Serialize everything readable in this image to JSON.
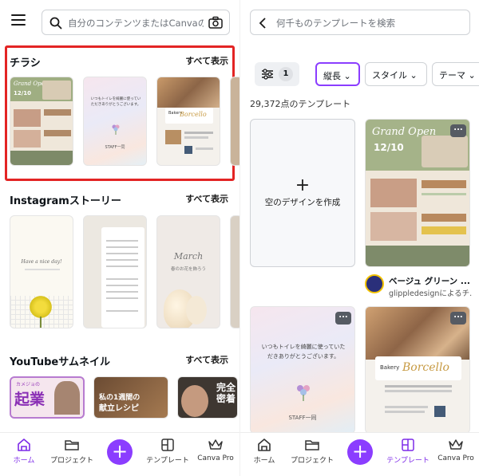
{
  "left": {
    "search_placeholder": "自分のコンテンツまたはCanvaのコン",
    "sections": [
      {
        "title": "チラシ",
        "see_all": "すべて表示"
      },
      {
        "title": "Instagramストーリー",
        "see_all": "すべて表示"
      },
      {
        "title": "YouTubeサムネイル",
        "see_all": "すべて表示"
      }
    ],
    "flyer_thumbs": {
      "grand_open_text": "Grand Open",
      "date_text": "12/10",
      "pastel_text": "いつもトイレを綺麗に使っていただきありがとうございます。",
      "pastel_staff": "STAFF一同",
      "bakery_text": "Bakery",
      "bakery_name": "Borcello"
    },
    "story_thumbs": {
      "story1_text": "Have a nice day!",
      "story3_title": "March",
      "story3_sub": "春のお花を飾ろう"
    },
    "yt_thumbs": {
      "yt1_small": "カメジョの",
      "yt1_big": "起業",
      "yt2_line1": "私の1週間の",
      "yt2_line2": "献立レシピ",
      "yt3_text": "完全密着"
    },
    "nav": [
      {
        "label": "ホーム",
        "icon": "home-icon"
      },
      {
        "label": "プロジェクト",
        "icon": "folder-icon"
      },
      {
        "label": "テンプレート",
        "icon": "template-icon"
      },
      {
        "label": "Canva Pro",
        "icon": "crown-icon"
      }
    ]
  },
  "right": {
    "search_placeholder": "何千ものテンプレートを検索",
    "filter_count": "1",
    "chips": [
      "縦長",
      "スタイル",
      "テーマ"
    ],
    "result_count": "29,372点のテンプレート",
    "create_blank": "空のデザインを作成",
    "create_plus": "+",
    "card_menu": "...",
    "author_title": "ベージュ グリーン ...",
    "author_name": "glippledesignによるチ...",
    "nav": [
      {
        "label": "ホーム",
        "icon": "home-icon"
      },
      {
        "label": "プロジェクト",
        "icon": "folder-icon"
      },
      {
        "label": "テンプレート",
        "icon": "template-icon"
      },
      {
        "label": "Canva Pro",
        "icon": "crown-icon"
      }
    ]
  },
  "colors": {
    "accent": "#8b3dff",
    "highlight": "#e32424"
  }
}
